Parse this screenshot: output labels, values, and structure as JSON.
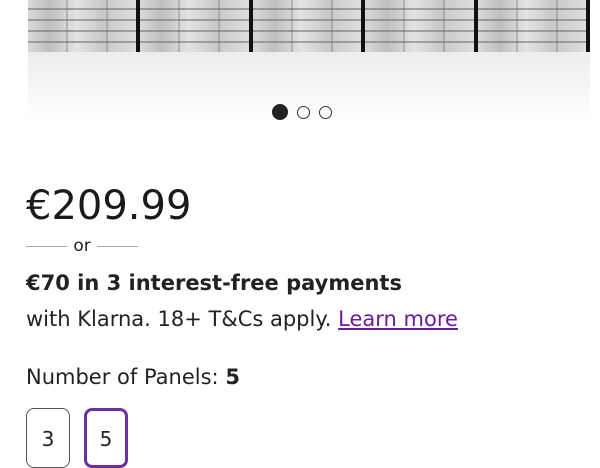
{
  "carousel": {
    "dot_count": 3,
    "active_index": 0
  },
  "product": {
    "price": "€209.99"
  },
  "klarna": {
    "or_label": "or",
    "headline": "€70 in 3 interest-free payments",
    "subtext": "with Klarna. 18+ T&Cs apply.",
    "learn_more": "Learn more"
  },
  "options": {
    "label": "Number of Panels:",
    "selected_value": "5",
    "choices": [
      "3",
      "5"
    ]
  },
  "colors": {
    "accent": "#6a2fa0",
    "link": "#6a1b9a"
  }
}
